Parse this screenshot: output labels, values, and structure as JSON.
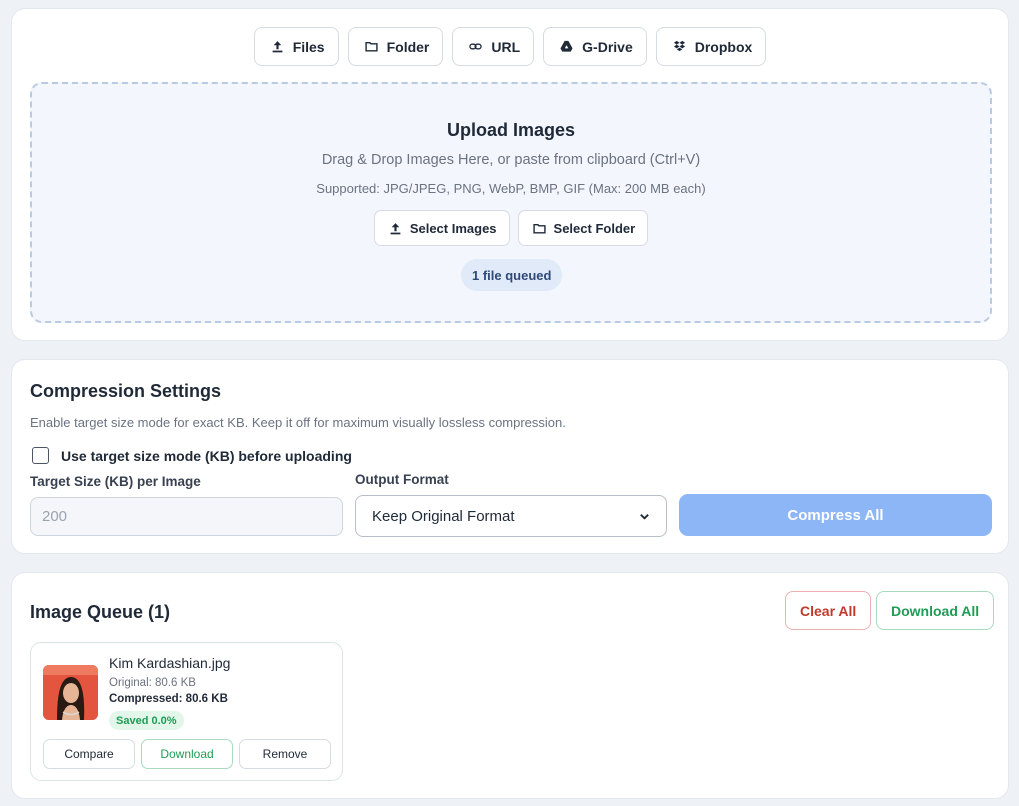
{
  "sources": [
    {
      "label": "Files",
      "icon": "upload-icon"
    },
    {
      "label": "Folder",
      "icon": "folder-icon"
    },
    {
      "label": "URL",
      "icon": "link-icon"
    },
    {
      "label": "G-Drive",
      "icon": "google-drive-icon"
    },
    {
      "label": "Dropbox",
      "icon": "dropbox-icon"
    }
  ],
  "upload": {
    "title": "Upload Images",
    "subtitle": "Drag & Drop Images Here, or paste from clipboard (Ctrl+V)",
    "supported": "Supported: JPG/JPEG, PNG, WebP, BMP, GIF (Max: 200 MB each)",
    "select_images": "Select Images",
    "select_folder": "Select Folder",
    "queued": "1 file queued"
  },
  "settings": {
    "title": "Compression Settings",
    "hint": "Enable target size mode for exact KB. Keep it off for maximum visually lossless compression.",
    "target_mode_label": "Use target size mode (KB) before uploading",
    "target_mode_checked": false,
    "target_size_label": "Target Size (KB) per Image",
    "target_size_placeholder": "200",
    "output_format_label": "Output Format",
    "output_format_value": "Keep Original Format",
    "compress_all": "Compress All"
  },
  "queue": {
    "title": "Image Queue (1)",
    "clear_all": "Clear All",
    "download_all": "Download All",
    "items": [
      {
        "name": "Kim Kardashian.jpg",
        "original": "Original: 80.6 KB",
        "compressed": "Compressed: 80.6 KB",
        "saved": "Saved 0.0%",
        "compare": "Compare",
        "download": "Download",
        "remove": "Remove"
      }
    ]
  },
  "colors": {
    "accent_disabled": "#8db6f7",
    "danger": "#c0392b",
    "success": "#1f9d55",
    "dropzone_bg": "#f3f7fd"
  }
}
